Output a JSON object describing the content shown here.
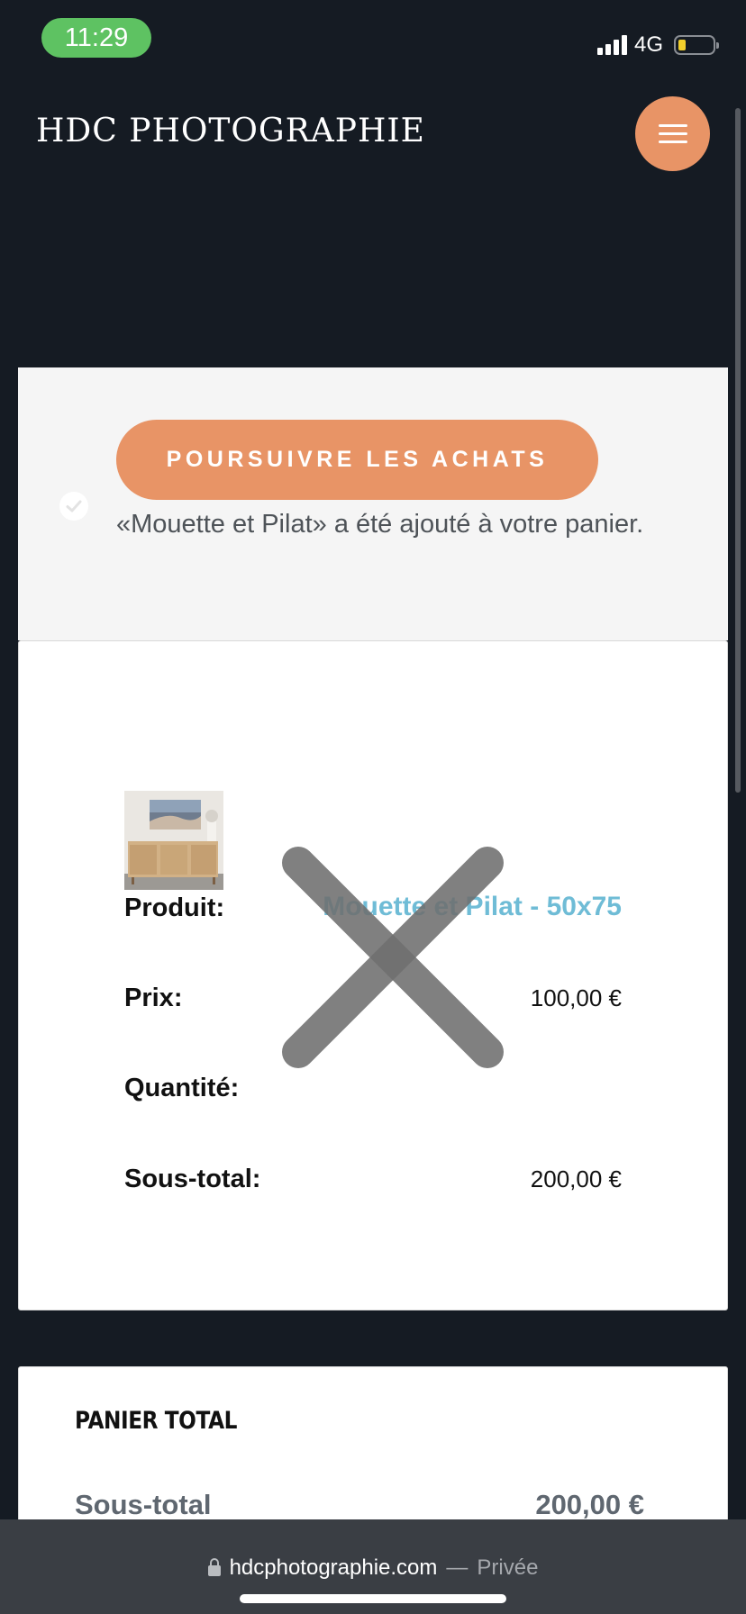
{
  "status_bar": {
    "time": "11:29",
    "network": "4G",
    "battery_level": 0.2
  },
  "header": {
    "logo": "HDC PHOTOGRAPHIE"
  },
  "notice": {
    "button_label": "POURSUIVRE LES ACHATS",
    "message": "«Mouette et Pilat» a été ajouté à votre panier."
  },
  "cart": {
    "product_label": "Produit:",
    "product_name": "Mouette et Pilat - 50x75",
    "price_label": "Prix:",
    "price_value": "100,00 €",
    "quantity_label": "Quantité:",
    "subtotal_label": "Sous-total:",
    "subtotal_value": "200,00 €"
  },
  "totals": {
    "title": "PANIER TOTAL",
    "subtotal_label": "Sous-total",
    "subtotal_value": "200,00 €"
  },
  "browser": {
    "domain": "hdcphotographie.com",
    "separator": "—",
    "mode": "Privée"
  },
  "colors": {
    "accent": "#e89466",
    "background": "#151b23",
    "link": "#6fbcd6",
    "status_time": "#5ec262"
  }
}
